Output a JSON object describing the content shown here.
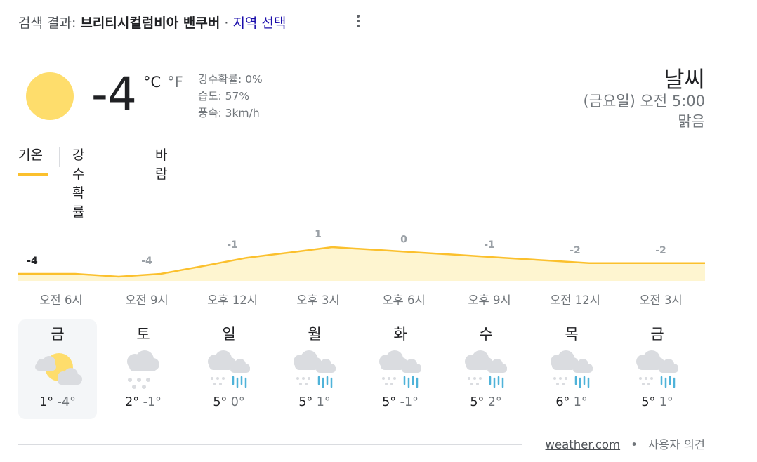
{
  "header": {
    "prefix": "검색 결과: ",
    "location": "브리티시컬럼비아 밴쿠버",
    "separator": " · ",
    "select_region": "지역 선택"
  },
  "current": {
    "icon": "sun-icon",
    "temperature": "-4",
    "unit_c": "°C",
    "unit_f": "°F",
    "precip": "강수확률: 0%",
    "humidity": "습도: 57%",
    "wind": "풍속: 3km/h"
  },
  "right": {
    "title": "날씨",
    "datetime": "(금요일) 오전 5:00",
    "condition": "맑음"
  },
  "tabs": [
    {
      "label": "기온"
    },
    {
      "label": "강수확률"
    },
    {
      "label": "바람"
    }
  ],
  "chart_data": {
    "type": "area",
    "x": [
      "오전 6시",
      "오전 9시",
      "오후 12시",
      "오후 3시",
      "오후 6시",
      "오후 9시",
      "오전 12시",
      "오전 3시"
    ],
    "values": [
      -4,
      -4,
      -1,
      1,
      0,
      -1,
      -2,
      -2
    ],
    "labels": [
      "-4",
      "-4",
      "-1",
      "1",
      "0",
      "-1",
      "-2",
      "-2"
    ],
    "line_color": "#fbc02d",
    "fill_color": "#fef5d0"
  },
  "days": [
    {
      "name": "금",
      "icon": "partly-cloudy-icon",
      "high": "1°",
      "low": "-4°"
    },
    {
      "name": "토",
      "icon": "snow-icon",
      "high": "2°",
      "low": "-1°"
    },
    {
      "name": "일",
      "icon": "rain-snow-icon",
      "high": "5°",
      "low": "0°"
    },
    {
      "name": "월",
      "icon": "rain-snow-icon",
      "high": "5°",
      "low": "1°"
    },
    {
      "name": "화",
      "icon": "rain-snow-icon",
      "high": "5°",
      "low": "-1°"
    },
    {
      "name": "수",
      "icon": "rain-snow-icon",
      "high": "5°",
      "low": "2°"
    },
    {
      "name": "목",
      "icon": "rain-snow-icon",
      "high": "6°",
      "low": "1°"
    },
    {
      "name": "금",
      "icon": "rain-snow-icon",
      "high": "5°",
      "low": "1°"
    }
  ],
  "footer": {
    "source": "weather.com",
    "dot": "•",
    "feedback": "사용자 의견"
  }
}
